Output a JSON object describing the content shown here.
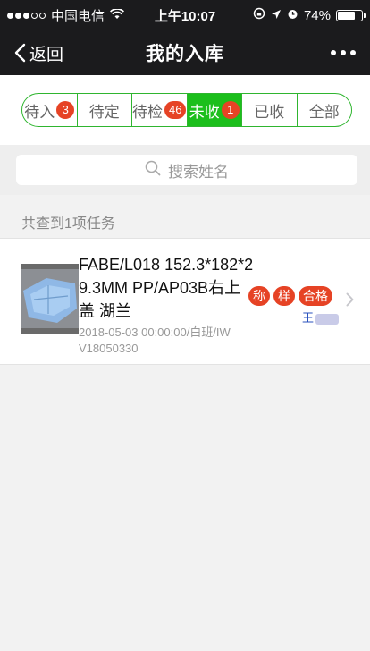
{
  "status_bar": {
    "carrier": "中国电信",
    "time": "上午10:07",
    "battery": "74%",
    "battery_level": 0.74
  },
  "nav": {
    "back_label": "返回",
    "title": "我的入库"
  },
  "tabs": [
    {
      "label": "待入",
      "badge": "3",
      "active": false
    },
    {
      "label": "待定",
      "badge": "",
      "active": false
    },
    {
      "label": "待检",
      "badge": "46",
      "active": false
    },
    {
      "label": "未收",
      "badge": "1",
      "active": true
    },
    {
      "label": "已收",
      "badge": "",
      "active": false
    },
    {
      "label": "全部",
      "badge": "",
      "active": false
    }
  ],
  "search": {
    "placeholder": "搜索姓名"
  },
  "result_count": "共查到1项任务",
  "items": [
    {
      "title": "FABE/L018 152.3*182*29.3MM PP/AP03B右上盖 湖兰",
      "subtitle": "2018-05-03 00:00:00/白班/IWV18050330",
      "tags": [
        "称",
        "样",
        "合格"
      ],
      "person": "王"
    }
  ],
  "colors": {
    "accent_green": "#1cbf1c",
    "badge_red": "#e64325",
    "nav_bg": "#1b1b1d"
  }
}
